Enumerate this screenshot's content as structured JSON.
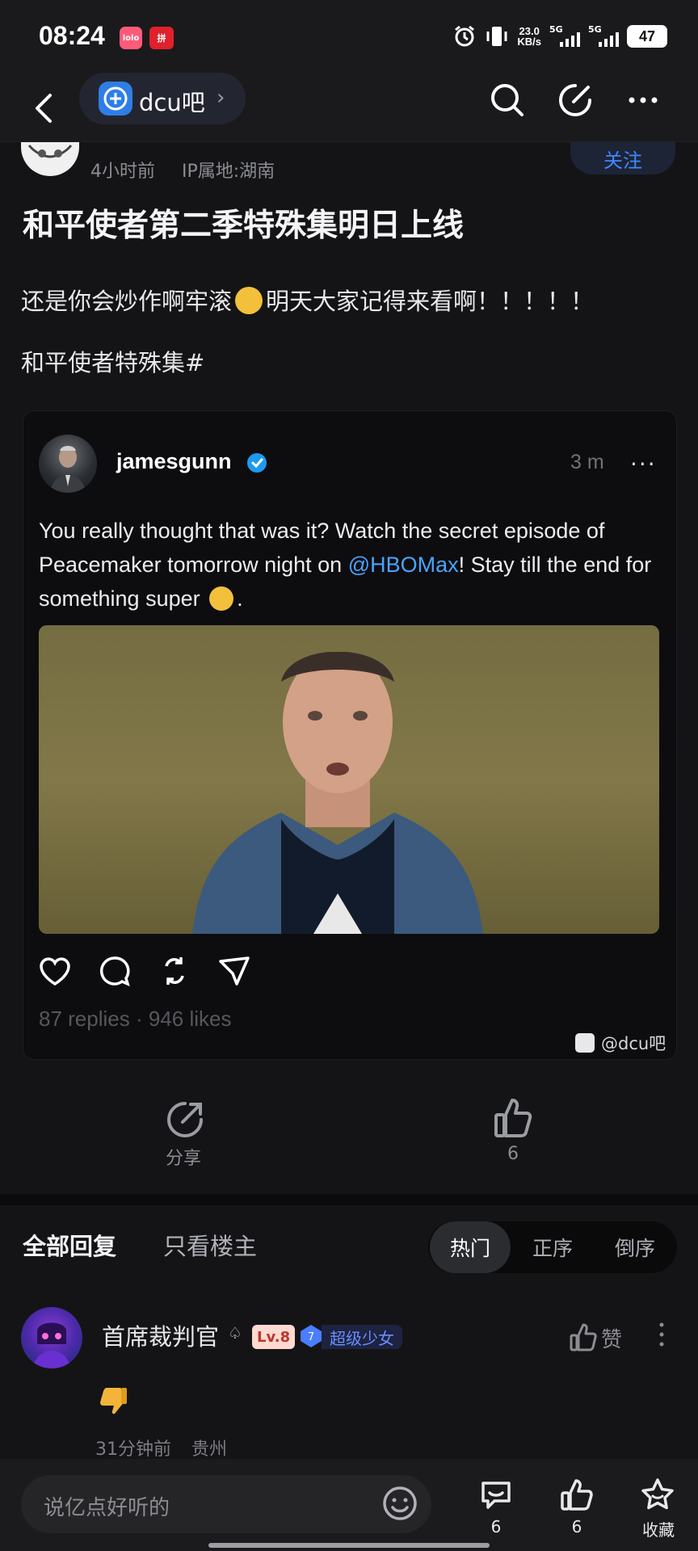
{
  "status_bar": {
    "time": "08:24",
    "app_badge_1": "lolo",
    "app_badge_2": "拼",
    "net_speed_value": "23.0",
    "net_speed_unit": "KB/s",
    "signal_1": "5G",
    "signal_2": "5G",
    "battery": "47"
  },
  "nav": {
    "forum_name": "dcu吧",
    "forum_chevron": "›"
  },
  "post": {
    "time": "4小时前",
    "ip": "IP属地:湖南",
    "follow_label": "关注",
    "title": "和平使者第二季特殊集明日上线",
    "body_before_emoji": "还是你会炒作啊牢滚",
    "body_after_emoji": "明天大家记得来看啊！！！！！",
    "tag_line": "和平使者特殊集#"
  },
  "embedded_tweet": {
    "username": "jamesgunn",
    "time": "3 m",
    "more": "···",
    "text_part1": "You really thought that was it? Watch the secret episode of Peacemaker tomorrow night on ",
    "mention": "@HBOMax",
    "text_part2": "! Stay till the end for something super ",
    "text_end": ".",
    "replies": "87 replies",
    "separator": "·",
    "likes": "946 likes",
    "watermark": "@dcu吧"
  },
  "actions": {
    "share_label": "分享",
    "like_count": "6"
  },
  "replies_header": {
    "all_replies": "全部回复",
    "host_only": "只看楼主",
    "sort_hot": "热门",
    "sort_asc": "正序",
    "sort_desc": "倒序"
  },
  "comment": {
    "username": "首席裁判官",
    "crown": "♤",
    "level": "Lv.8",
    "gem_level": "7",
    "title_badge": "超级少女",
    "like_label": "赞",
    "time": "31分钟前",
    "location": "贵州"
  },
  "bottom_bar": {
    "input_placeholder": "说亿点好听的",
    "comment_count": "6",
    "like_count": "6",
    "favorite_label": "收藏"
  },
  "colors": {
    "background": "#141416",
    "accent_blue": "#3f88ff",
    "mention_blue": "#4ba3ff",
    "muted_text": "#8b8d93"
  }
}
